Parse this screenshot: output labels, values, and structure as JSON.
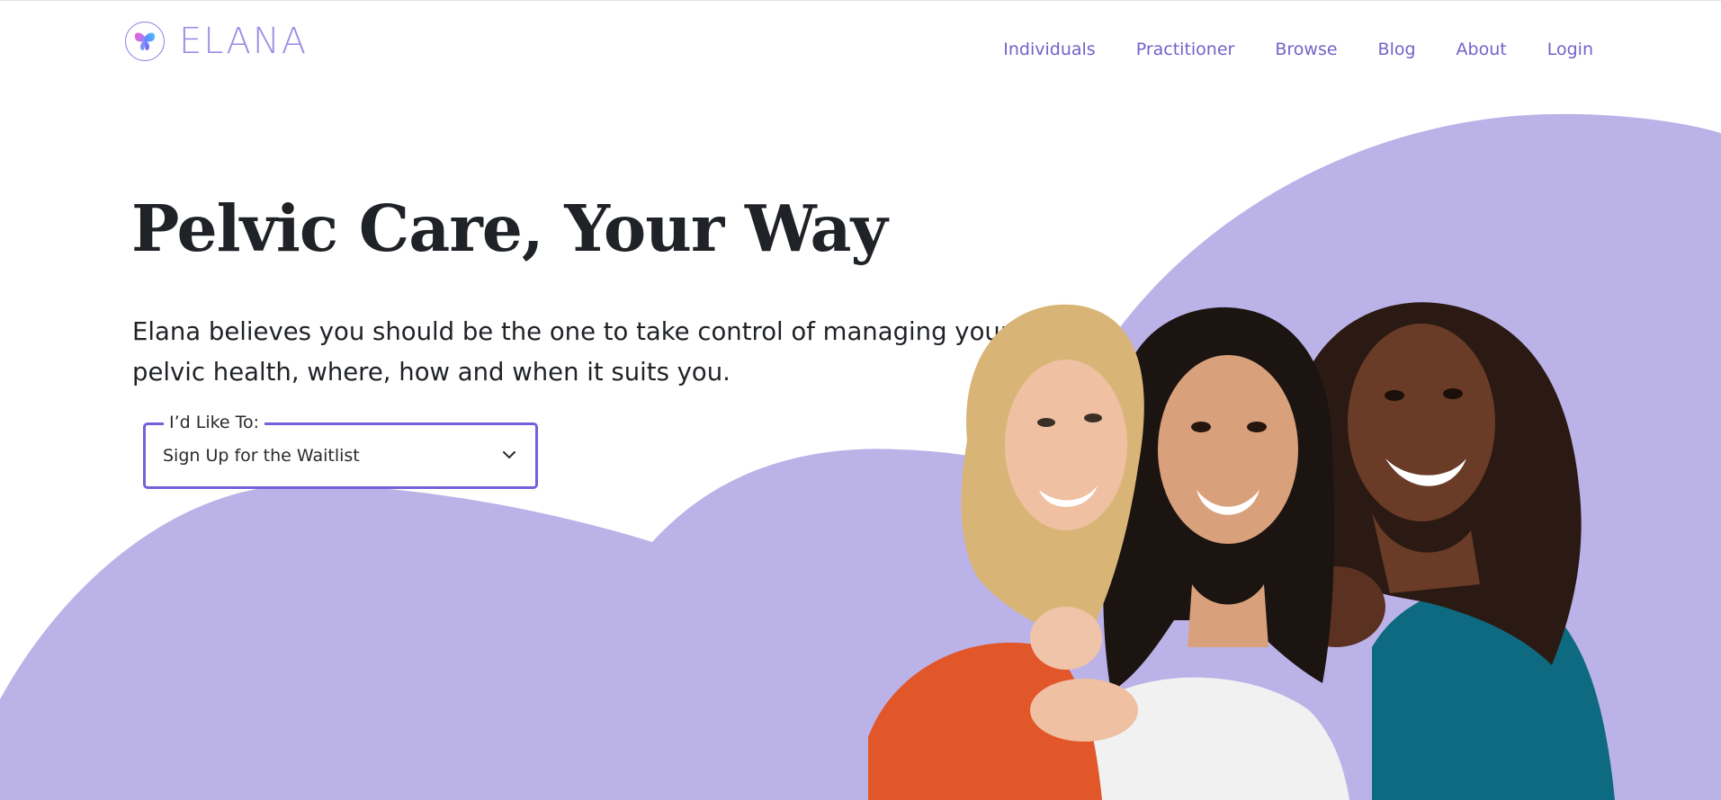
{
  "brand": {
    "name": "ELANA",
    "logo_icon": "butterfly-icon",
    "accent_color": "#7263c9",
    "blob_color": "#bbb3e8"
  },
  "nav": {
    "items": [
      {
        "label": "Individuals"
      },
      {
        "label": "Practitioner"
      },
      {
        "label": "Browse"
      },
      {
        "label": "Blog"
      },
      {
        "label": "About"
      },
      {
        "label": "Login"
      }
    ]
  },
  "hero": {
    "title": "Pelvic Care, Your Way",
    "subtitle": "Elana believes you should be the one to take control of managing your pelvic health, where, how and when it suits you."
  },
  "select": {
    "legend": "I’d Like To:",
    "value": "Sign Up for the Waitlist",
    "icon": "chevron-down-icon"
  }
}
